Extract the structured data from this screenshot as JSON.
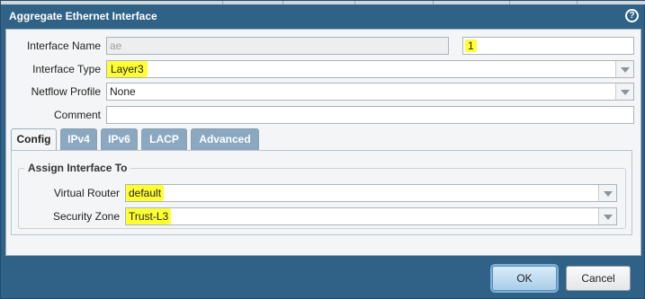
{
  "dialog": {
    "title": "Aggregate Ethernet Interface",
    "help_icon": "?"
  },
  "form": {
    "interface_name": {
      "label": "Interface Name",
      "prefix": "ae",
      "value": "1"
    },
    "interface_type": {
      "label": "Interface Type",
      "value": "Layer3"
    },
    "netflow_profile": {
      "label": "Netflow Profile",
      "value": "None"
    },
    "comment": {
      "label": "Comment",
      "value": ""
    }
  },
  "tabs": [
    {
      "label": "Config",
      "active": true
    },
    {
      "label": "IPv4",
      "active": false
    },
    {
      "label": "IPv6",
      "active": false
    },
    {
      "label": "LACP",
      "active": false
    },
    {
      "label": "Advanced",
      "active": false
    }
  ],
  "config": {
    "group_title": "Assign Interface To",
    "virtual_router": {
      "label": "Virtual Router",
      "value": "default"
    },
    "security_zone": {
      "label": "Security Zone",
      "value": "Trust-L3"
    }
  },
  "footer": {
    "ok_label": "OK",
    "cancel_label": "Cancel"
  },
  "colors": {
    "title_bar": "#2f6286",
    "highlight": "#ffff33",
    "tab_inactive": "#8aa8c0"
  }
}
